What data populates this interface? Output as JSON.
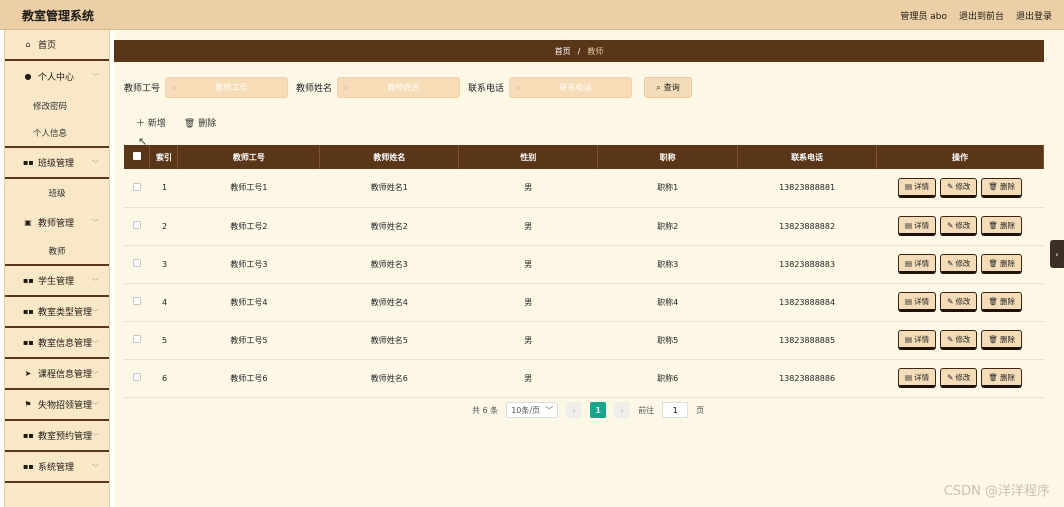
{
  "header": {
    "title": "教室管理系统",
    "admin_label": "管理员 abo",
    "to_front": "退出到前台",
    "logout": "退出登录"
  },
  "sidebar": {
    "home": "首页",
    "personal_center": "个人中心",
    "change_password": "修改密码",
    "personal_info": "个人信息",
    "class_mgmt": "班级管理",
    "class_sub": "班级",
    "teacher_mgmt": "教师管理",
    "teacher_sub": "教师",
    "student_mgmt": "学生管理",
    "room_type_mgmt": "教室类型管理",
    "room_info_mgmt": "教室信息管理",
    "course_info_mgmt": "课程信息管理",
    "lost_found_mgmt": "失物招领管理",
    "room_booking_mgmt": "教室预约管理",
    "system_mgmt": "系统管理"
  },
  "breadcrumb": {
    "home": "首页",
    "separator": "/",
    "current": "教师"
  },
  "search": {
    "field1_label": "教师工号",
    "field1_placeholder": "教师工号",
    "field2_label": "教师姓名",
    "field2_placeholder": "教师姓名",
    "field3_label": "联系电话",
    "field3_placeholder": "联系电话",
    "query_label": "查询"
  },
  "actions": {
    "add_label": "新增",
    "delete_label": "删除"
  },
  "table": {
    "headers": [
      "索引",
      "教师工号",
      "教师姓名",
      "性别",
      "职称",
      "联系电话",
      "操作"
    ],
    "op_detail": "详情",
    "op_edit": "修改",
    "op_delete": "删除",
    "rows": [
      {
        "index": "1",
        "id": "教师工号1",
        "name": "教师姓名1",
        "gender": "男",
        "title": "职称1",
        "phone": "13823888881"
      },
      {
        "index": "2",
        "id": "教师工号2",
        "name": "教师姓名2",
        "gender": "男",
        "title": "职称2",
        "phone": "13823888882"
      },
      {
        "index": "3",
        "id": "教师工号3",
        "name": "教师姓名3",
        "gender": "男",
        "title": "职称3",
        "phone": "13823888883"
      },
      {
        "index": "4",
        "id": "教师工号4",
        "name": "教师姓名4",
        "gender": "男",
        "title": "职称4",
        "phone": "13823888884"
      },
      {
        "index": "5",
        "id": "教师工号5",
        "name": "教师姓名5",
        "gender": "男",
        "title": "职称5",
        "phone": "13823888885"
      },
      {
        "index": "6",
        "id": "教师工号6",
        "name": "教师姓名6",
        "gender": "男",
        "title": "职称6",
        "phone": "13823888886"
      }
    ]
  },
  "pagination": {
    "total": "共 6 条",
    "page_size": "10条/页",
    "current_page": "1",
    "goto_label": "前往",
    "goto_value": "1",
    "page_unit": "页"
  },
  "watermark": "CSDN @洋洋程序",
  "colors": {
    "header_bg": "#ebcfa7",
    "brown": "#5a3619",
    "sidebar_bg": "#f8e8c7",
    "main_bg": "#fdf8e6",
    "accent_green": "#17a589"
  }
}
